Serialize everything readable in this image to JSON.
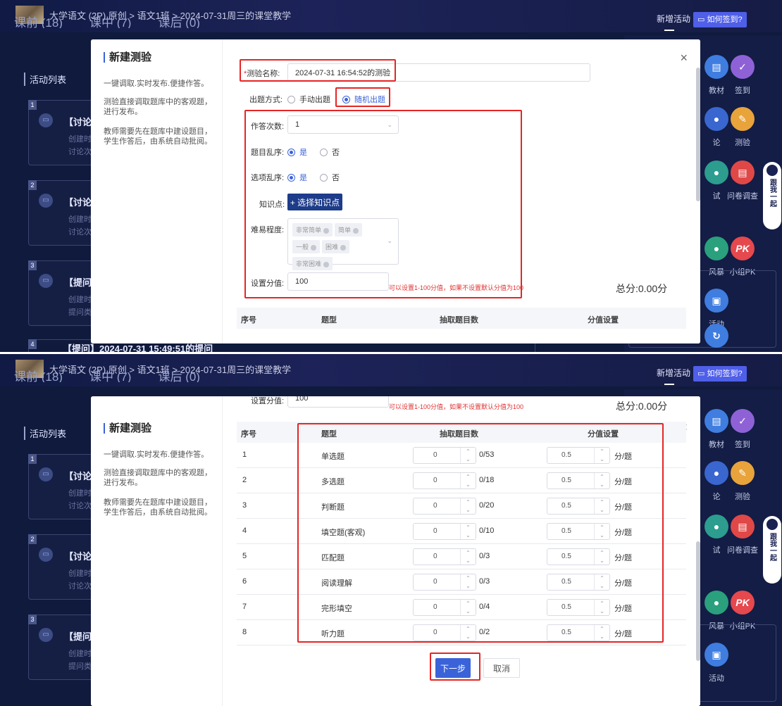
{
  "header": {
    "breadcrumb": "大学语文 (2P) 原创 > 语文1班 > 2024-07-31周三的课堂教学",
    "new_activity": "新增活动",
    "how_signin": "▭ 如何签到?"
  },
  "tabs": {
    "before": "课前 (18)",
    "during": "课中 (7)",
    "after": "课后 (0)"
  },
  "sidebar": {
    "activity_list": "活动列表"
  },
  "cards": [
    {
      "num": "1",
      "title": "【讨论】",
      "line1": "创建时",
      "line2": "讨论次"
    },
    {
      "num": "2",
      "title": "【讨论】",
      "line1": "创建时",
      "line2": "讨论次"
    },
    {
      "num": "3",
      "title": "【提问】",
      "line1": "创建时",
      "line2": "提问类"
    }
  ],
  "bottom_item": {
    "num": "4",
    "title": "【提问】2024-07-31 15:49:51的提问"
  },
  "tools": [
    {
      "label": "教材",
      "color": "#3f7de0"
    },
    {
      "label": "签到",
      "color": "#8e62d6"
    },
    {
      "label": "论",
      "color": "#3a66cf"
    },
    {
      "label": "测验",
      "color": "#e8a33b"
    },
    {
      "label": "试",
      "color": "#2c9d8e"
    },
    {
      "label": "问卷调查",
      "color": "#e04848"
    },
    {
      "label": "风暴",
      "color": "#2aa07d"
    },
    {
      "label": "小组PK",
      "color": "#e5484d"
    },
    {
      "label": "活动",
      "color": "#3f7de0"
    }
  ],
  "robot": {
    "text": "跟我一起"
  },
  "modal": {
    "title": "新建测验",
    "desc1": "一键调取.实时发布.便捷作答。",
    "desc2": "测验直接调取题库中的客观题，进行发布。",
    "desc3": "教师需要先在题库中建设题目，学生作答后，由系统自动批阅。",
    "close": "×",
    "name_label": "测验名称:",
    "name_value": "2024-07-31 16:54:52的测验",
    "mode_label": "出题方式:",
    "mode_manual": "手动出题",
    "mode_random": "随机出题",
    "attempts_label": "作答次数:",
    "attempts_value": "1",
    "shuffle_q_label": "题目乱序:",
    "shuffle_o_label": "选项乱序:",
    "yes": "是",
    "no": "否",
    "knowledge_label": "知识点:",
    "knowledge_btn": "+ 选择知识点",
    "difficulty_label": "难易程度:",
    "difficulty_tags": [
      "非常简单",
      "简单",
      "一般",
      "困难",
      "非常困难"
    ],
    "score_label": "设置分值:",
    "score_value": "100",
    "score_hint": "可以设置1-100分值，如果不设置默认分值为100",
    "total": "总分:0.00分",
    "table_headers": [
      "序号",
      "题型",
      "抽取题目数",
      "分值设置"
    ],
    "rows": [
      {
        "no": "1",
        "type": "单选题",
        "count": "0",
        "max": "0/53",
        "score": "0.5",
        "unit": "分/题"
      },
      {
        "no": "2",
        "type": "多选题",
        "count": "0",
        "max": "0/18",
        "score": "0.5",
        "unit": "分/题"
      },
      {
        "no": "3",
        "type": "判断题",
        "count": "0",
        "max": "0/20",
        "score": "0.5",
        "unit": "分/题"
      },
      {
        "no": "4",
        "type": "填空题(客观)",
        "count": "0",
        "max": "0/10",
        "score": "0.5",
        "unit": "分/题"
      },
      {
        "no": "5",
        "type": "匹配题",
        "count": "0",
        "max": "0/3",
        "score": "0.5",
        "unit": "分/题"
      },
      {
        "no": "6",
        "type": "阅读理解",
        "count": "0",
        "max": "0/3",
        "score": "0.5",
        "unit": "分/题"
      },
      {
        "no": "7",
        "type": "完形填空",
        "count": "0",
        "max": "0/4",
        "score": "0.5",
        "unit": "分/题"
      },
      {
        "no": "8",
        "type": "听力题",
        "count": "0",
        "max": "0/2",
        "score": "0.5",
        "unit": "分/题"
      }
    ],
    "next": "下一步",
    "cancel": "取消"
  },
  "colors": {
    "accent": "#3a63d9",
    "highlight": "#e52525",
    "dark_bg": "#0f1a3d"
  }
}
